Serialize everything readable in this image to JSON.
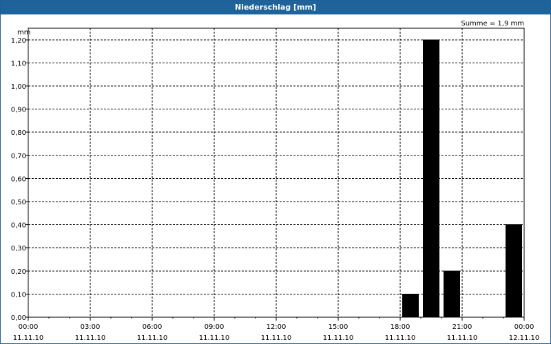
{
  "window": {
    "title": "Niederschlag [mm]"
  },
  "summary": "Summe = 1,9 mm",
  "colors": {
    "titlebar": "#1f639b",
    "bar": "#000000",
    "grid": "#000000"
  },
  "chart_data": {
    "type": "bar",
    "title": "Niederschlag [mm]",
    "unit_label": "mm",
    "xlabel": "",
    "ylabel": "mm",
    "ylim": [
      0,
      1.25
    ],
    "y_ticks": [
      "0,00",
      "0,10",
      "0,20",
      "0,30",
      "0,40",
      "0,50",
      "0,60",
      "0,70",
      "0,80",
      "0,90",
      "1,00",
      "1,10",
      "1,20"
    ],
    "x_range_hours": [
      0,
      24
    ],
    "x_ticks": [
      {
        "time": "00:00",
        "date": "11.11.10"
      },
      {
        "time": "03:00",
        "date": "11.11.10"
      },
      {
        "time": "06:00",
        "date": "11.11.10"
      },
      {
        "time": "09:00",
        "date": "11.11.10"
      },
      {
        "time": "12:00",
        "date": "11.11.10"
      },
      {
        "time": "15:00",
        "date": "11.11.10"
      },
      {
        "time": "18:00",
        "date": "11.11.10"
      },
      {
        "time": "21:00",
        "date": "11.11.10"
      },
      {
        "time": "00:00",
        "date": "12.11.10"
      }
    ],
    "bars": [
      {
        "start": "11.11.10 18:00",
        "end": "11.11.10 19:00",
        "value": 0.1
      },
      {
        "start": "11.11.10 19:00",
        "end": "11.11.10 20:00",
        "value": 1.2
      },
      {
        "start": "11.11.10 20:00",
        "end": "11.11.10 21:00",
        "value": 0.2
      },
      {
        "start": "11.11.10 23:00",
        "end": "12.11.10 00:00",
        "value": 0.4
      }
    ],
    "grid": true,
    "legend": "none"
  }
}
